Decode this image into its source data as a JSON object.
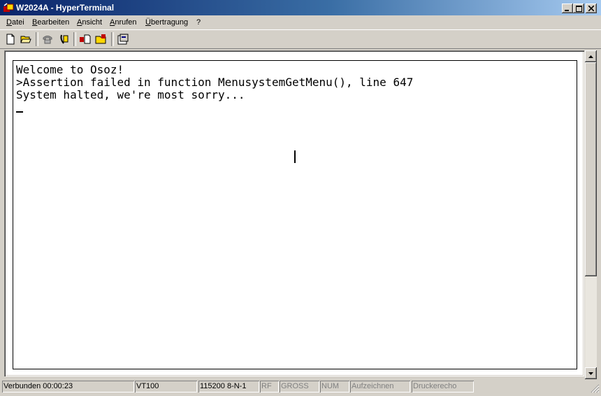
{
  "window": {
    "title": "W2024A - HyperTerminal",
    "buttons": {
      "minimize": "minimize-icon",
      "maximize": "maximize-icon",
      "close": "close-icon"
    }
  },
  "menu": {
    "items": [
      "Datei",
      "Bearbeiten",
      "Ansicht",
      "Anrufen",
      "Übertragung",
      "?"
    ]
  },
  "toolbar": {
    "icons": [
      "new-document-icon",
      "open-folder-icon",
      "connect-phone-icon",
      "disconnect-phone-icon",
      "send-file-icon",
      "receive-file-icon",
      "properties-icon"
    ]
  },
  "terminal": {
    "lines": [
      "Welcome to Osoz!",
      ">Assertion failed in function MenusystemGetMenu(), line 647",
      "System halted, we're most sorry..."
    ]
  },
  "statusbar": {
    "connected": "Verbunden 00:00:23",
    "emulation": "VT100",
    "settings": "115200 8-N-1",
    "scroll": "RF",
    "caps": "GROSS",
    "num": "NUM",
    "capture": "Aufzeichnen",
    "printecho": "Druckerecho"
  },
  "colors": {
    "titlebar_start": "#0a246a",
    "titlebar_end": "#a6caf0",
    "chrome": "#d4d0c8"
  }
}
